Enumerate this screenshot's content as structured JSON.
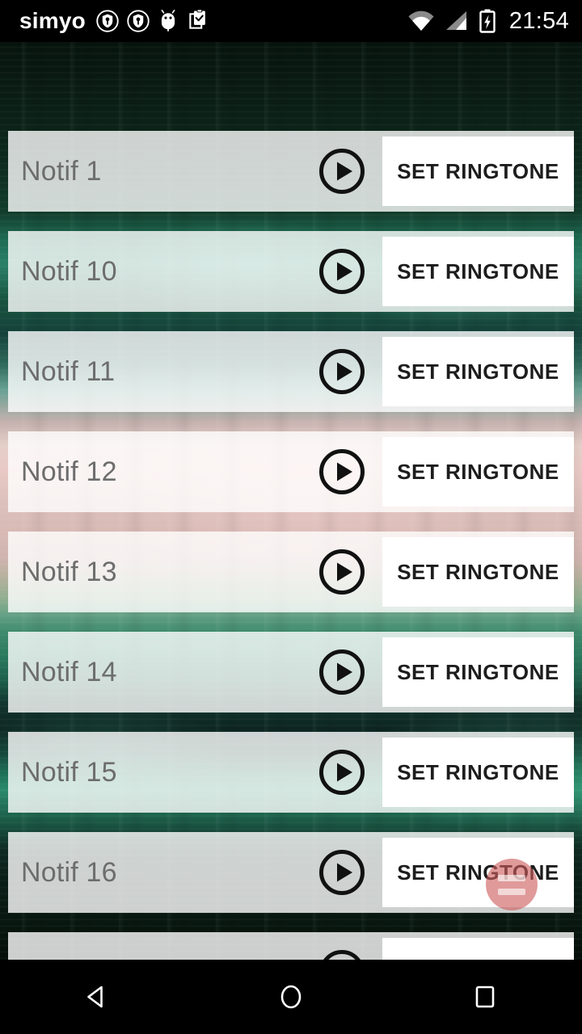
{
  "status_bar": {
    "carrier": "simyo",
    "clock": "21:54",
    "left_icons": [
      {
        "name": "vpn-key-shield-icon-1",
        "glyph": "shield-key"
      },
      {
        "name": "vpn-key-shield-icon-2",
        "glyph": "shield-key"
      },
      {
        "name": "android-debug-icon",
        "glyph": "android"
      },
      {
        "name": "clipboard-check-icon",
        "glyph": "clipboard"
      }
    ],
    "right_icons": [
      {
        "name": "wifi-icon",
        "glyph": "wifi"
      },
      {
        "name": "cellular-signal-icon",
        "glyph": "signal"
      },
      {
        "name": "battery-charging-icon",
        "glyph": "battery-charging"
      }
    ]
  },
  "app": {
    "button_label": "SET RINGTONE",
    "play_icon_name": "play-circle-icon",
    "accent_fab_color": "#cd5c5c",
    "row_text_color": "#6d6d6d",
    "button_text_color": "#1d1d1d",
    "rows": [
      {
        "label": "Notif 1"
      },
      {
        "label": "Notif 10"
      },
      {
        "label": "Notif 11"
      },
      {
        "label": "Notif 12"
      },
      {
        "label": "Notif 13"
      },
      {
        "label": "Notif 14"
      },
      {
        "label": "Notif 15"
      },
      {
        "label": "Notif 16"
      },
      {
        "label": ""
      }
    ]
  },
  "fab": {
    "name": "menu-fab",
    "icon": "hamburger-menu-icon"
  },
  "nav_bar": {
    "back_label": "Back",
    "home_label": "Home",
    "recents_label": "Recent apps"
  }
}
